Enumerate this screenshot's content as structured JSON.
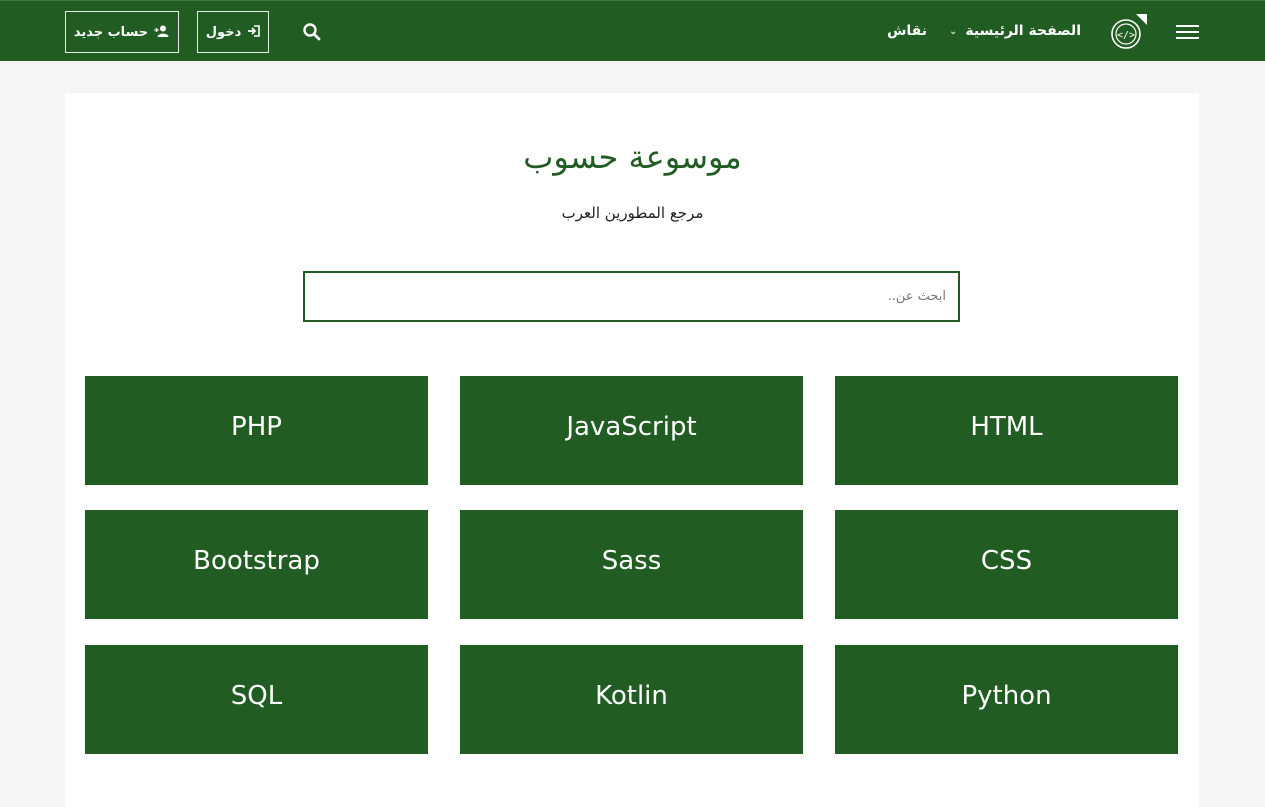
{
  "header": {
    "home_label": "الصفحة الرئيسية",
    "discuss_label": "نقاش",
    "login_label": "دخول",
    "signup_label": "حساب جديد"
  },
  "hero": {
    "title": "موسوعة حسوب",
    "subtitle": "مرجع المطورين العرب"
  },
  "search": {
    "placeholder": "ابحث عن.."
  },
  "tiles": [
    {
      "label": "HTML"
    },
    {
      "label": "JavaScript"
    },
    {
      "label": "PHP"
    },
    {
      "label": "CSS"
    },
    {
      "label": "Sass"
    },
    {
      "label": "Bootstrap"
    },
    {
      "label": "Python"
    },
    {
      "label": "Kotlin"
    },
    {
      "label": "SQL"
    }
  ],
  "colors": {
    "brand_green": "#215c22",
    "background": "#f5f5f5"
  },
  "icons": [
    "menu-icon",
    "logo-icon",
    "chevron-down-icon",
    "search-icon",
    "login-icon",
    "add-user-icon"
  ]
}
